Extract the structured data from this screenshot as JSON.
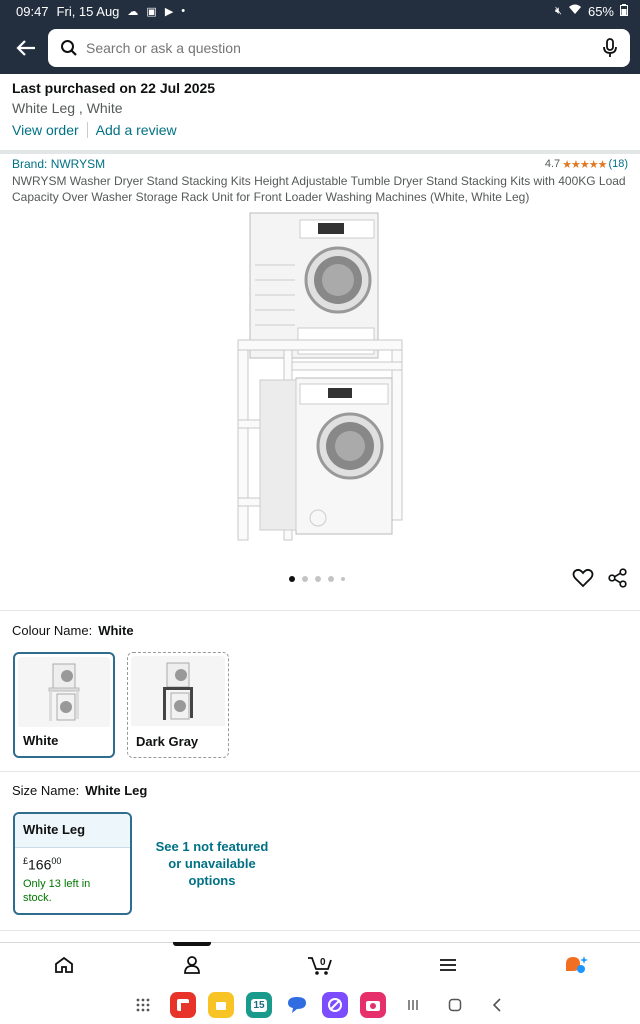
{
  "status": {
    "time": "09:47",
    "date": "Fri, 15 Aug",
    "battery": "65%"
  },
  "search": {
    "placeholder": "Search or ask a question"
  },
  "purchase": {
    "title": "Last purchased on 22 Jul 2025",
    "variant": "White Leg , White",
    "view_order": "View order",
    "add_review": "Add a review"
  },
  "product": {
    "brand": "Brand: NWRYSM",
    "rating_value": "4.7",
    "rating_stars": "★★★★★",
    "rating_count": "(18)",
    "title": "NWRYSM Washer Dryer Stand Stacking Kits Height Adjustable Tumble Dryer Stand Stacking Kits with 400KG Load Capacity Over Washer Storage Rack Unit for Front Loader Washing Machines (White, White Leg)"
  },
  "colour": {
    "label": "Colour Name:",
    "selected": "White",
    "options": [
      {
        "name": "White"
      },
      {
        "name": "Dark Gray"
      }
    ]
  },
  "size": {
    "label": "Size Name:",
    "selected": "White Leg",
    "card_name": "White Leg",
    "currency": "£",
    "price_whole": "166",
    "price_fraction": "00",
    "stock": "Only 13 left in stock.",
    "see_more": "See 1 not featured or unavailable options"
  },
  "taskbar": {
    "calendar_day": "15"
  },
  "colors": {
    "header_bg": "#232f3e",
    "link": "#007185",
    "selected_border": "#2f6d8e",
    "stock": "#007600",
    "star": "#de7921"
  }
}
